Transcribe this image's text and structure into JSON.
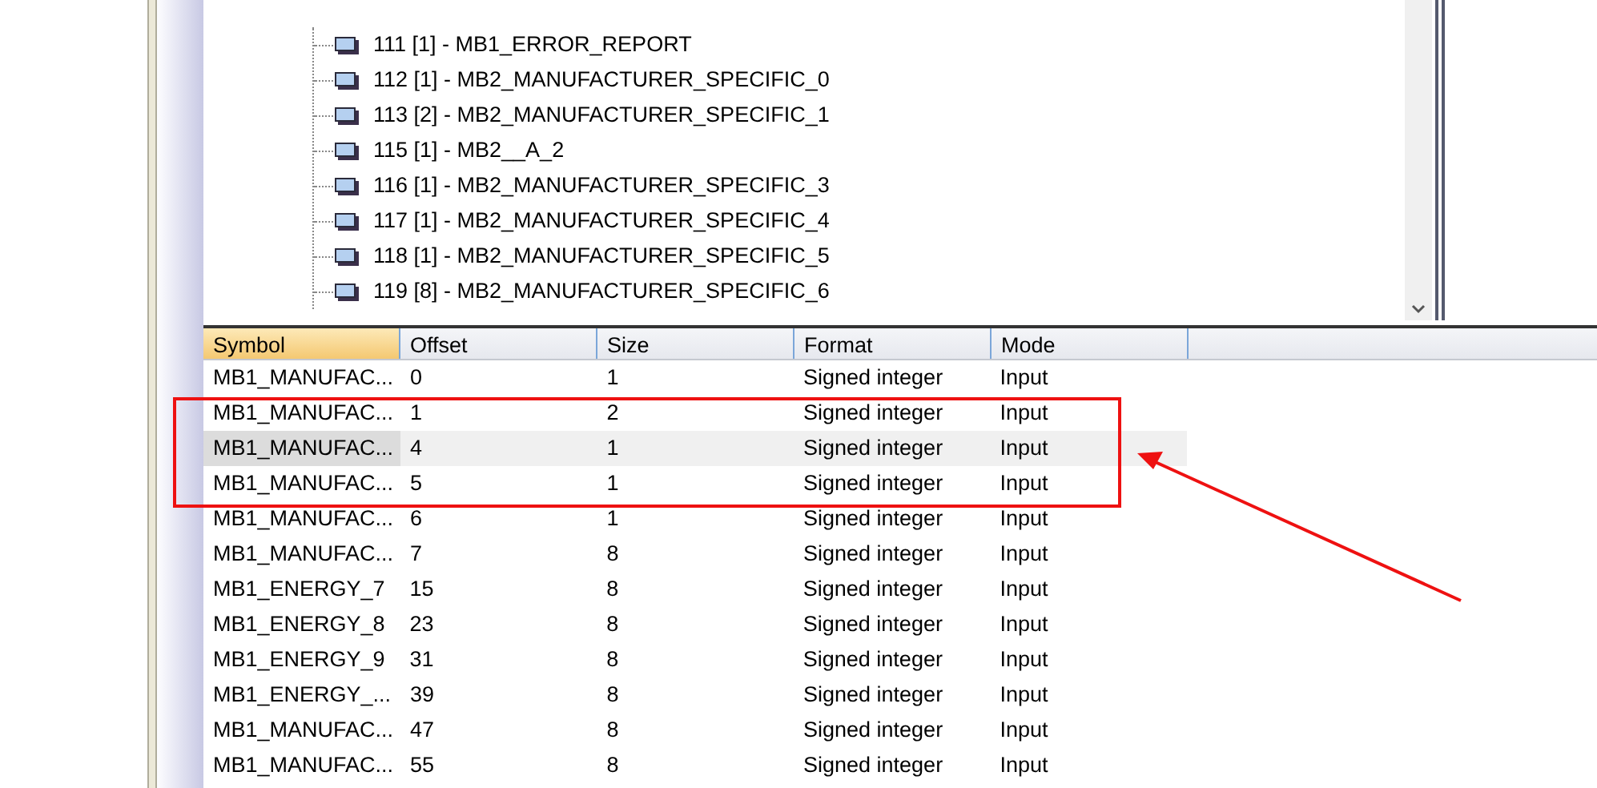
{
  "tree": {
    "items": [
      {
        "label": "111 [1] - MB1_ERROR_REPORT"
      },
      {
        "label": "112 [1] - MB2_MANUFACTURER_SPECIFIC_0"
      },
      {
        "label": "113 [2] - MB2_MANUFACTURER_SPECIFIC_1"
      },
      {
        "label": "115 [1] - MB2__A_2"
      },
      {
        "label": "116 [1] - MB2_MANUFACTURER_SPECIFIC_3"
      },
      {
        "label": "117 [1] - MB2_MANUFACTURER_SPECIFIC_4"
      },
      {
        "label": "118 [1] - MB2_MANUFACTURER_SPECIFIC_5"
      },
      {
        "label": "119 [8] - MB2_MANUFACTURER_SPECIFIC_6"
      }
    ]
  },
  "table": {
    "columns": [
      {
        "label": "Symbol",
        "sorted": true
      },
      {
        "label": "Offset",
        "sorted": false
      },
      {
        "label": "Size",
        "sorted": false
      },
      {
        "label": "Format",
        "sorted": false
      },
      {
        "label": "Mode",
        "sorted": false
      }
    ],
    "rows": [
      {
        "cells": [
          "MB1_MANUFAC...",
          "0",
          "1",
          "Signed integer",
          "Input"
        ],
        "selected": false
      },
      {
        "cells": [
          "MB1_MANUFAC...",
          "1",
          "2",
          "Signed integer",
          "Input"
        ],
        "selected": false
      },
      {
        "cells": [
          "MB1_MANUFAC...",
          "4",
          "1",
          "Signed integer",
          "Input"
        ],
        "selected": true
      },
      {
        "cells": [
          "MB1_MANUFAC...",
          "5",
          "1",
          "Signed integer",
          "Input"
        ],
        "selected": false
      },
      {
        "cells": [
          "MB1_MANUFAC...",
          "6",
          "1",
          "Signed integer",
          "Input"
        ],
        "selected": false
      },
      {
        "cells": [
          "MB1_MANUFAC...",
          "7",
          "8",
          "Signed integer",
          "Input"
        ],
        "selected": false
      },
      {
        "cells": [
          "MB1_ENERGY_7",
          "15",
          "8",
          "Signed integer",
          "Input"
        ],
        "selected": false
      },
      {
        "cells": [
          "MB1_ENERGY_8",
          "23",
          "8",
          "Signed integer",
          "Input"
        ],
        "selected": false
      },
      {
        "cells": [
          "MB1_ENERGY_9",
          "31",
          "8",
          "Signed integer",
          "Input"
        ],
        "selected": false
      },
      {
        "cells": [
          "MB1_ENERGY_...",
          "39",
          "8",
          "Signed integer",
          "Input"
        ],
        "selected": false
      },
      {
        "cells": [
          "MB1_MANUFAC...",
          "47",
          "8",
          "Signed integer",
          "Input"
        ],
        "selected": false
      },
      {
        "cells": [
          "MB1_MANUFAC...",
          "55",
          "8",
          "Signed integer",
          "Input"
        ],
        "selected": false
      }
    ]
  }
}
